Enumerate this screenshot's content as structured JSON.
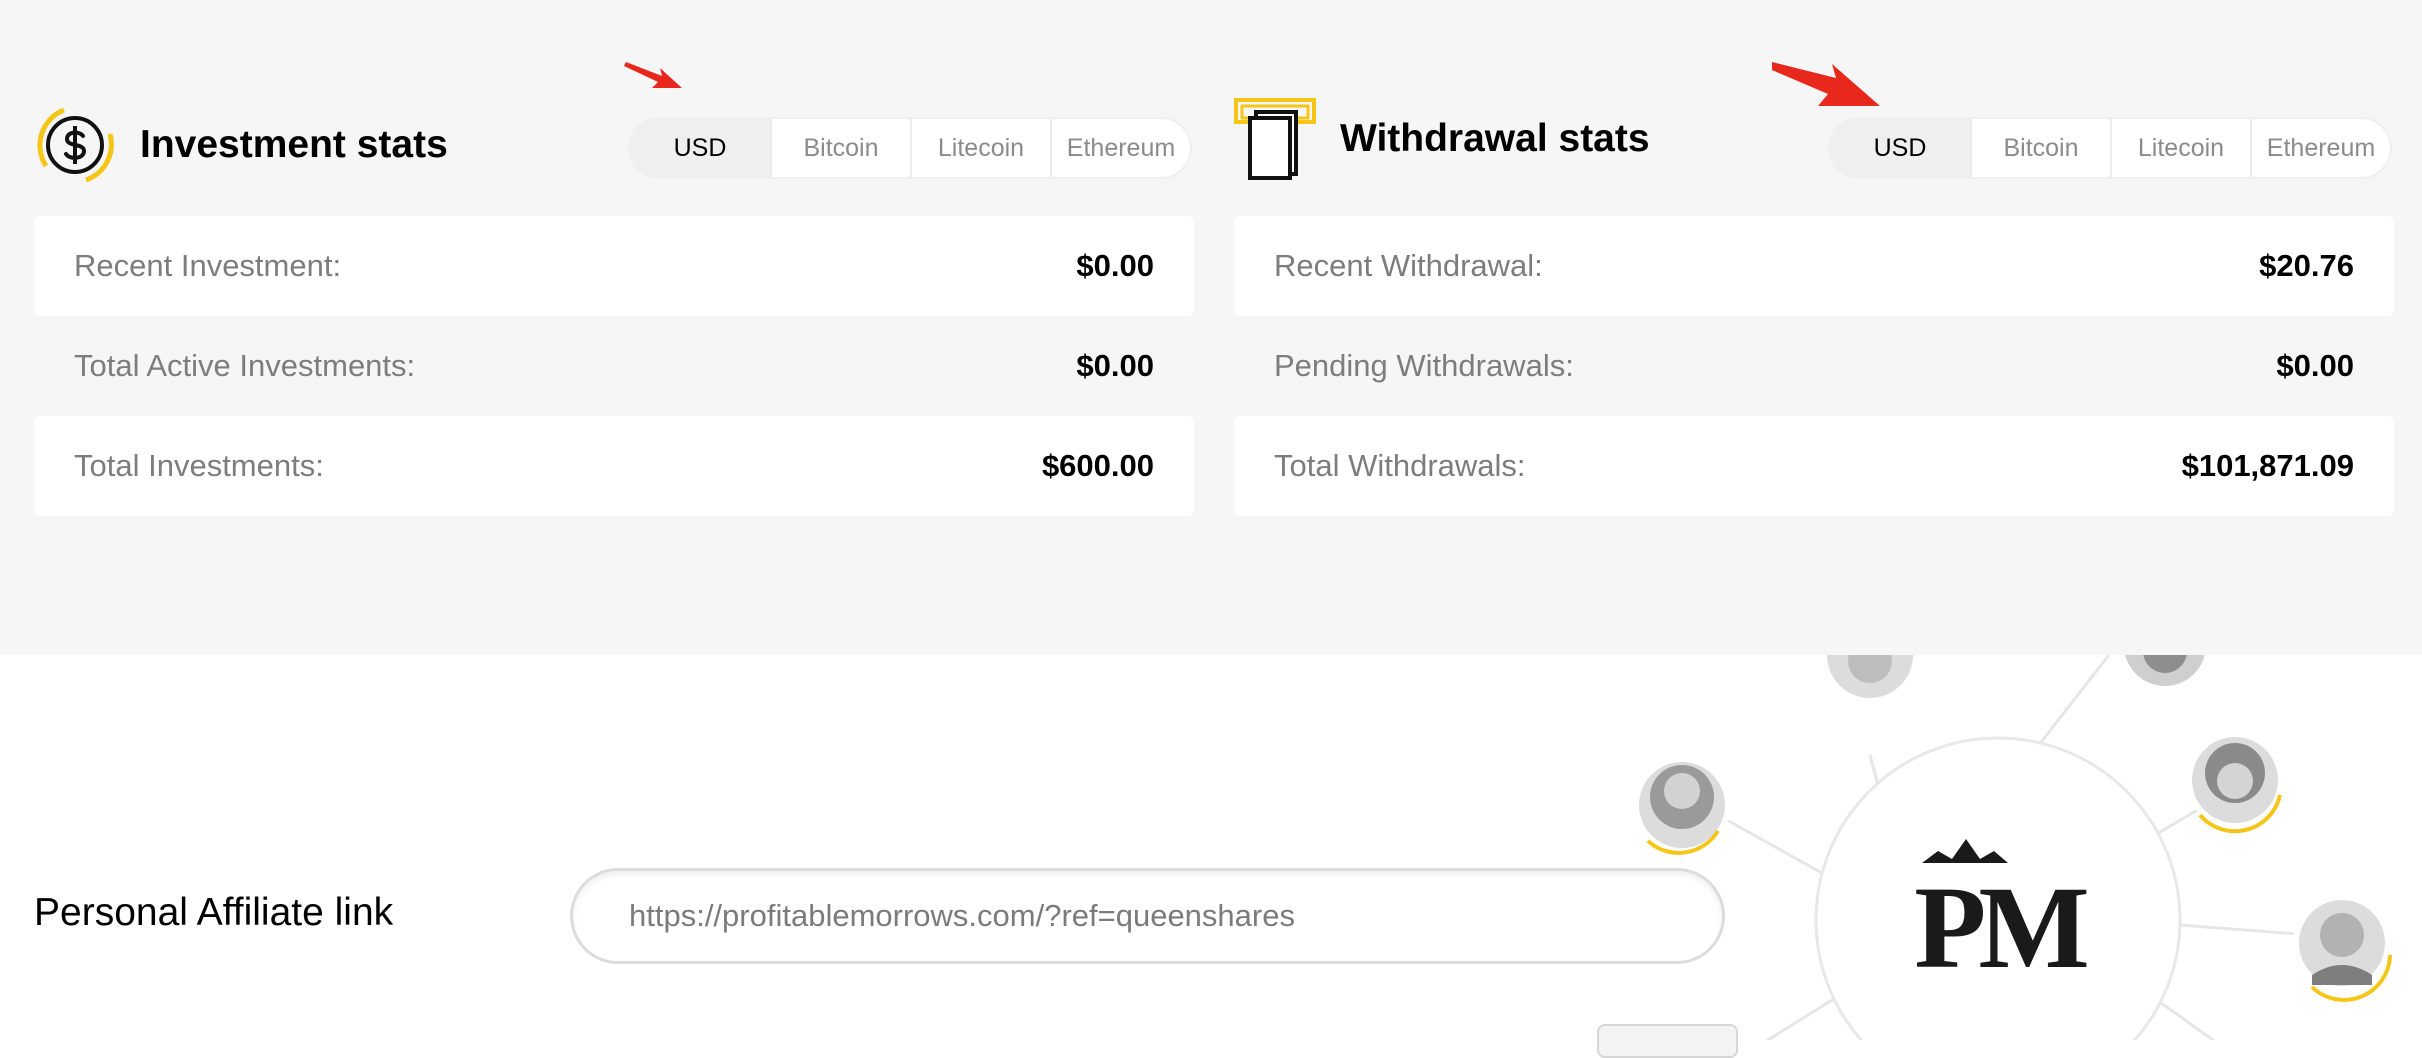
{
  "investment": {
    "title": "Investment stats",
    "icon": "dollar-coin-icon",
    "tabs": [
      "USD",
      "Bitcoin",
      "Litecoin",
      "Ethereum"
    ],
    "active_tab": "USD",
    "rows": [
      {
        "label": "Recent Investment:",
        "value": "$0.00"
      },
      {
        "label": "Total Active Investments:",
        "value": "$0.00"
      },
      {
        "label": "Total Investments:",
        "value": "$600.00"
      }
    ]
  },
  "withdrawal": {
    "title": "Withdrawal stats",
    "icon": "atm-withdraw-icon",
    "tabs": [
      "USD",
      "Bitcoin",
      "Litecoin",
      "Ethereum"
    ],
    "active_tab": "USD",
    "rows": [
      {
        "label": "Recent Withdrawal:",
        "value": "$20.76"
      },
      {
        "label": "Pending Withdrawals:",
        "value": "$0.00"
      },
      {
        "label": "Total Withdrawals:",
        "value": "$101,871.09"
      }
    ]
  },
  "affiliate": {
    "label": "Personal Affiliate link",
    "link": "https://profitablemorrows.com/?ref=queenshares"
  },
  "colors": {
    "accent_yellow": "#f5c518",
    "annotation_red": "#e8281c",
    "band_background": "#f6f6f6"
  }
}
